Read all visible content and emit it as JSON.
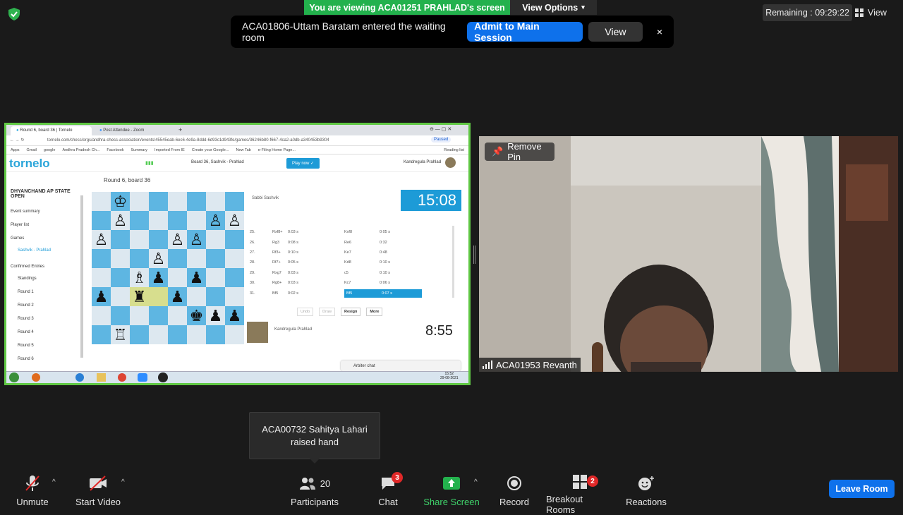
{
  "banner": {
    "viewing": "You are viewing ACA01251 PRAHLAD's screen",
    "view_options": "View Options"
  },
  "timer": {
    "remaining": "Remaining : 09:29:22",
    "view": "View"
  },
  "notification": {
    "message": "ACA01806-Uttam Baratam entered the waiting room",
    "admit": "Admit to Main Session",
    "view": "View",
    "close": "×"
  },
  "browser": {
    "tabs": [
      "Round 6, board 36 | Tornelo",
      "Post Attendee - Zoom"
    ],
    "url": "tornelo.com/chess/orgs/andhra-chess-association/events/45545eab-6ec6-4e9a-8ddd-6d93c1d943fe/games/36246b80-f667-4ca2-a0db-a340453b9304",
    "paused": "Paused",
    "bookmarks": [
      "Apps",
      "Gmail",
      "google",
      "Andhra Pradesh Ch...",
      "Facebook",
      "Summary",
      "Imported From IE",
      "Create your Google...",
      "New Tab",
      "e-Filing Home Page...",
      "Reading list"
    ]
  },
  "tornelo": {
    "logo": "tornelo",
    "board_label": "Board 36, Sashvik - Prahlad",
    "play_now": "Play now ✓",
    "user": "Kandregula Prahlad",
    "event_title": "DHYANCHAND AP STATE OPEN",
    "round_title": "Round 6, board 36",
    "sidebar": [
      "Event summary",
      "Player list",
      "Games",
      "Sashvik - Prahlad",
      "Confirmed Entries",
      "Standings",
      "Round 1",
      "Round 2",
      "Round 3",
      "Round 4",
      "Round 5",
      "Round 6"
    ],
    "opponent": "Sabbi Sashvik",
    "opponent_clock": "15:08",
    "player": "Kandregula Prahlad",
    "player_clock": "8:55",
    "moves": [
      {
        "n": "25.",
        "w": "Rxf8+",
        "wt": "0:03 s",
        "b": "Kxf8",
        "bt": "0:05 s"
      },
      {
        "n": "26.",
        "w": "Rg3",
        "wt": "0:08 s",
        "b": "Re6",
        "bt": "0:32"
      },
      {
        "n": "27.",
        "w": "Rf3+",
        "wt": "0:10 s",
        "b": "Ke7",
        "bt": "0:48"
      },
      {
        "n": "28.",
        "w": "Rf7+",
        "wt": "0:05 s",
        "b": "Kd8",
        "bt": "0:10 s"
      },
      {
        "n": "29.",
        "w": "Rxg7",
        "wt": "0:03 s",
        "b": "c5",
        "bt": "0:10 s"
      },
      {
        "n": "30.",
        "w": "Rg8+",
        "wt": "0:03 s",
        "b": "Kc7",
        "bt": "0:06 s"
      },
      {
        "n": "31.",
        "w": "Bf5",
        "wt": "0:02 s",
        "b": "Bf5",
        "bt": "0:07 s"
      }
    ],
    "controls": [
      "Undo",
      "Draw",
      "Resign",
      "More"
    ],
    "arbiter": "Arbiter chat",
    "taskbar_time": "15:52",
    "taskbar_date": "29-08-2021",
    "board": [
      [
        "",
        "♔",
        "",
        "",
        "",
        "",
        "",
        ""
      ],
      [
        "",
        "♙",
        "",
        "",
        "",
        "",
        "♙",
        "♙"
      ],
      [
        "♙",
        "",
        "",
        "",
        "♙",
        "♙",
        "",
        ""
      ],
      [
        "",
        "",
        "",
        "♙",
        "",
        "",
        "",
        ""
      ],
      [
        "",
        "",
        "♗",
        "♟",
        "",
        "♟",
        "",
        ""
      ],
      [
        "♟",
        "",
        "♜",
        "",
        "♟",
        "",
        "",
        ""
      ],
      [
        "",
        "",
        "",
        "",
        "",
        "♚",
        "♟",
        "♟"
      ],
      [
        "",
        "♖",
        "",
        "",
        "",
        "",
        "",
        ""
      ]
    ]
  },
  "camera": {
    "remove_pin": "Remove Pin",
    "name": "ACA01953 Revanth"
  },
  "tooltip": {
    "text": "ACA00732 Sahitya Lahari raised hand"
  },
  "toolbar": {
    "unmute": "Unmute",
    "start_video": "Start Video",
    "participants": "Participants",
    "participants_count": "20",
    "chat": "Chat",
    "chat_badge": "3",
    "share": "Share Screen",
    "record": "Record",
    "breakout": "Breakout Rooms",
    "breakout_badge": "2",
    "reactions": "Reactions",
    "leave": "Leave Room"
  }
}
